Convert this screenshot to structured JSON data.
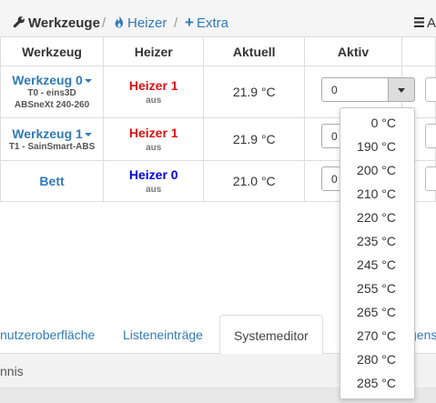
{
  "breadcrumb": {
    "tools": "Werkzeuge",
    "heater": "Heizer",
    "extra": "Extra",
    "separator": "/",
    "menu_right": "A"
  },
  "table": {
    "headers": [
      "Werkzeug",
      "Heizer",
      "Aktuell",
      "Aktiv"
    ],
    "rows": [
      {
        "tool": "Werkzeug 0",
        "sub1": "T0 - eins3D",
        "sub2": "ABSneXt 240-260",
        "heater": "Heizer 1",
        "heater_state": "aus",
        "actual": "21.9 °C",
        "active": "0"
      },
      {
        "tool": "Werkzeug 1",
        "sub1": "T1 - SainSmart-ABS",
        "heater": "Heizer 1",
        "heater_state": "aus",
        "actual": "21.9 °C",
        "active": "0"
      },
      {
        "tool": "Bett",
        "heater": "Heizer 0",
        "heater_state": "aus",
        "actual": "21.0 °C",
        "active": "0"
      }
    ]
  },
  "dropdown": {
    "options": [
      "0 °C",
      "190 °C",
      "200 °C",
      "210 °C",
      "220 °C",
      "235 °C",
      "245 °C",
      "255 °C",
      "265 °C",
      "270 °C",
      "280 °C",
      "285 °C"
    ]
  },
  "tabs": [
    {
      "label": "nutzeroberfläche"
    },
    {
      "label": "Listeneinträge"
    },
    {
      "label": "Systemeditor",
      "active": true
    },
    {
      "label": "gens"
    }
  ],
  "subbar": {
    "label": "nnis"
  },
  "colors": {
    "link": "#337ab7",
    "heater_hot": "#e01010",
    "heater_bed": "#0000e0"
  }
}
